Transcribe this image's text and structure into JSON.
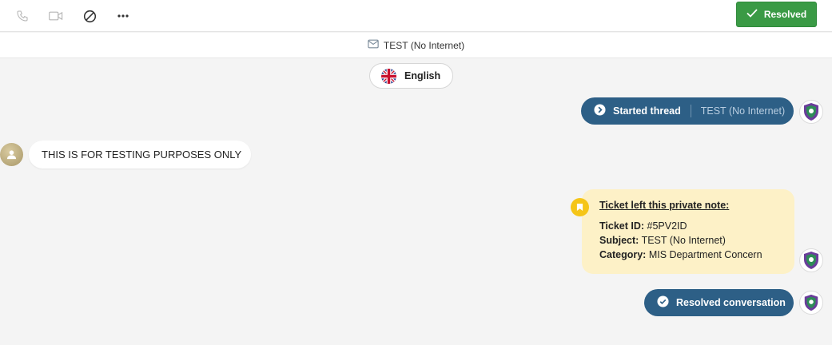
{
  "toolbar": {
    "icons": [
      "phone-icon",
      "video-icon",
      "block-icon",
      "more-options-icon"
    ],
    "resolved_label": "Resolved"
  },
  "subject_bar": {
    "icon": "envelope-icon",
    "text": "TEST (No Internet)"
  },
  "language": {
    "flag": "uk-flag-icon",
    "label": "English"
  },
  "thread_started": {
    "label": "Started thread",
    "subject": "TEST (No Internet)"
  },
  "customer_message": {
    "text": "THIS IS FOR TESTING PURPOSES ONLY"
  },
  "private_note": {
    "title": "Ticket left this private note:",
    "ticket_id_label": "Ticket ID:",
    "ticket_id": "#5PV2ID",
    "subject_label": "Subject:",
    "subject": "TEST (No Internet)",
    "category_label": "Category:",
    "category": "MIS Department Concern"
  },
  "resolved_event": {
    "label": "Resolved conversation"
  },
  "colors": {
    "accent": "#2d5f86",
    "resolved": "#3a9a45",
    "note_bg": "#fdf1c7",
    "note_badge": "#f5c518"
  }
}
